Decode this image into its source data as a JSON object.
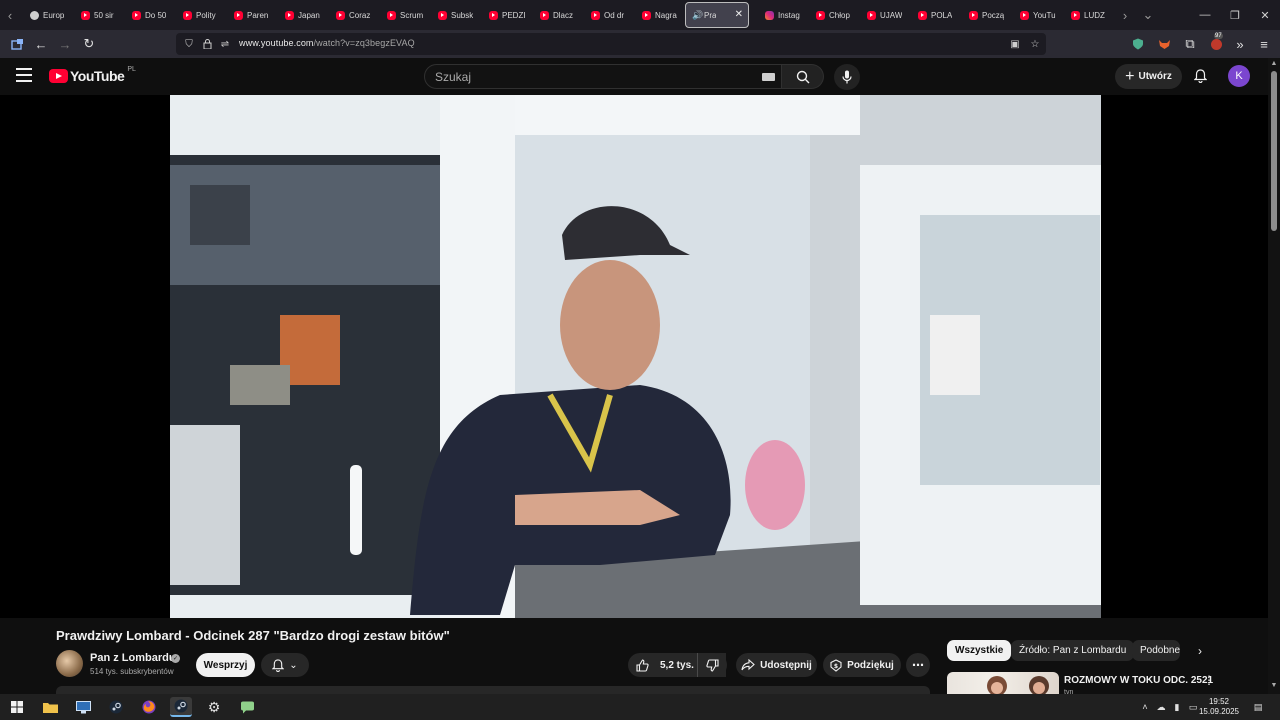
{
  "browser": {
    "tabs": [
      {
        "label": "Europ",
        "icon": "globe-icon"
      },
      {
        "label": "50 sir",
        "icon": "youtube-icon"
      },
      {
        "label": "Do 50",
        "icon": "youtube-icon"
      },
      {
        "label": "Polity",
        "icon": "youtube-icon"
      },
      {
        "label": "Paren",
        "icon": "youtube-icon"
      },
      {
        "label": "Japan",
        "icon": "youtube-icon"
      },
      {
        "label": "Coraz",
        "icon": "youtube-icon"
      },
      {
        "label": "Scrum",
        "icon": "youtube-icon"
      },
      {
        "label": "Subsk",
        "icon": "youtube-icon"
      },
      {
        "label": "PEDZI",
        "icon": "youtube-icon"
      },
      {
        "label": "Dlacz",
        "icon": "youtube-icon"
      },
      {
        "label": "Od dr",
        "icon": "youtube-icon"
      },
      {
        "label": "Nagra",
        "icon": "youtube-icon"
      },
      {
        "label": "Pra",
        "icon": "speaker-icon",
        "active": true
      },
      {
        "label": "Instag",
        "icon": "instagram-icon"
      },
      {
        "label": "Chłop",
        "icon": "youtube-icon"
      },
      {
        "label": "UJAW",
        "icon": "youtube-icon"
      },
      {
        "label": "POLA",
        "icon": "youtube-icon"
      },
      {
        "label": "Począ",
        "icon": "youtube-icon"
      },
      {
        "label": "YouTu",
        "icon": "youtube-icon"
      },
      {
        "label": "LUDZ",
        "icon": "youtube-icon"
      }
    ],
    "url_host": "www.youtube.com",
    "url_path": "/watch?v=zq3begzEVAQ",
    "extension_badge": "97"
  },
  "youtube": {
    "logo_text": "YouTube",
    "country": "PL",
    "search_placeholder": "Szukaj",
    "create_label": "Utwórz",
    "avatar_letter": "K",
    "accent": "#ff0033"
  },
  "video": {
    "title": "Prawdziwy Lombard - Odcinek 287 \"Bardzo drogi zestaw bitów\"",
    "channel": "Pan z Lombardu",
    "subscribers": "514 tys. subskrybentów",
    "support_label": "Wesprzyj",
    "likes": "5,2 tys.",
    "share_label": "Udostępnij",
    "thanks_label": "Podziękuj"
  },
  "sidebar": {
    "chips": [
      "Wszystkie",
      "Źródło: Pan z Lombardu",
      "Podobne"
    ],
    "recommendation": {
      "title": "ROZMOWY W TOKU ODC. 2521",
      "meta": "tvn"
    }
  },
  "taskbar": {
    "time": "19:52",
    "date": "15.09.2025"
  }
}
